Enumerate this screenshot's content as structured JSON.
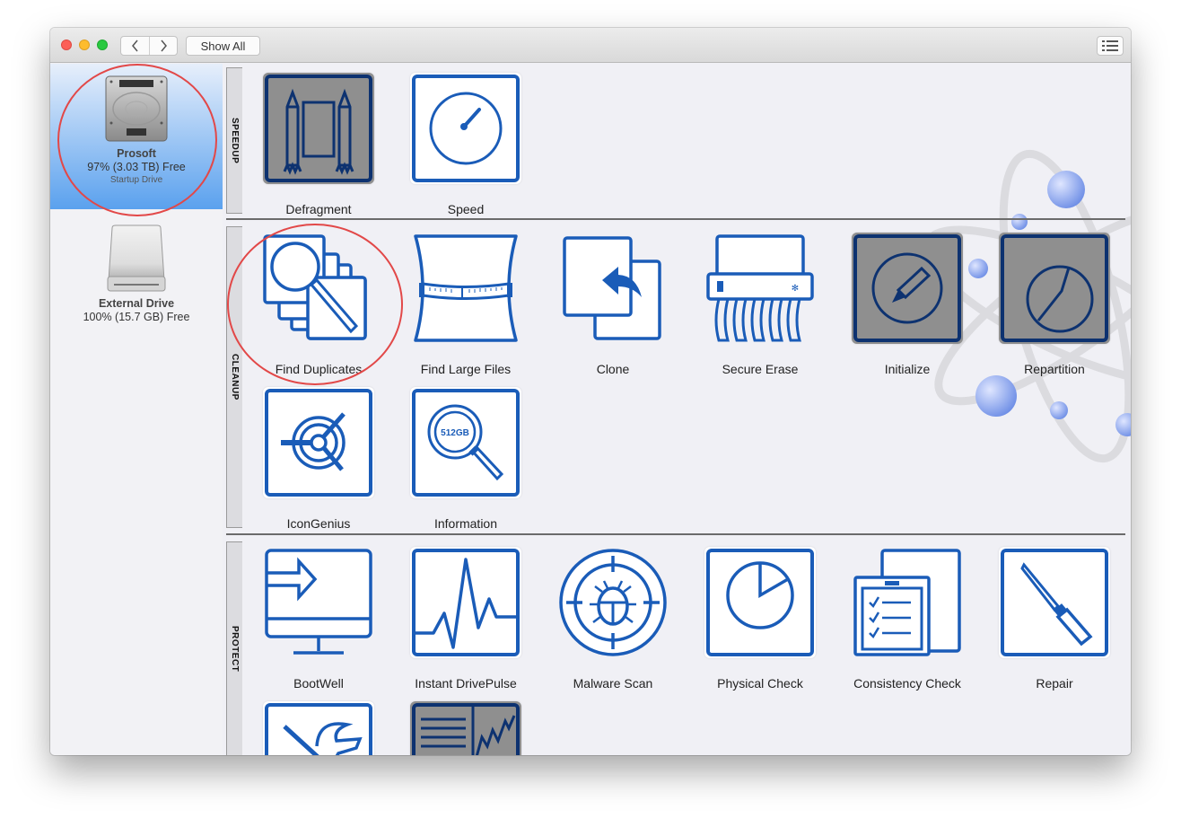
{
  "titlebar": {
    "back_label": "<",
    "forward_label": ">",
    "show_all_label": "Show All",
    "view_icon": "list-view-icon"
  },
  "sidebar": {
    "drives": [
      {
        "name": "Prosoft",
        "free": "97% (3.03 TB) Free",
        "subtitle": "Startup Drive",
        "icon": "hard-drive-icon",
        "selected": true
      },
      {
        "name": "External Drive",
        "free": "100% (15.7 GB) Free",
        "icon": "external-drive-icon",
        "selected": false
      }
    ]
  },
  "sections": [
    {
      "label": "SPEEDUP",
      "tools": [
        {
          "label": "Defragment",
          "icon": "defragment-rockets-icon",
          "enabled": false
        },
        {
          "label": "Speed",
          "icon": "speedometer-icon",
          "enabled": true
        }
      ]
    },
    {
      "label": "CLEANUP",
      "tools": [
        {
          "label": "Find Duplicates",
          "icon": "find-duplicates-icon",
          "enabled": true
        },
        {
          "label": "Find Large Files",
          "icon": "measuring-tape-icon",
          "enabled": true
        },
        {
          "label": "Clone",
          "icon": "clone-icon",
          "enabled": true
        },
        {
          "label": "Secure Erase",
          "icon": "shredder-icon",
          "enabled": true
        },
        {
          "label": "Initialize",
          "icon": "pencil-circle-icon",
          "enabled": false
        },
        {
          "label": "Repartition",
          "icon": "partition-pie-icon",
          "enabled": false
        },
        {
          "label": "IconGenius",
          "icon": "target-icon",
          "enabled": true
        },
        {
          "label": "Information",
          "icon": "magnifier-512gb-icon",
          "enabled": true,
          "badge": "512GB"
        }
      ]
    },
    {
      "label": "PROTECT",
      "tools": [
        {
          "label": "BootWell",
          "icon": "monitor-arrow-icon",
          "enabled": true
        },
        {
          "label": "Instant DrivePulse",
          "icon": "pulse-chart-icon",
          "enabled": true
        },
        {
          "label": "Malware Scan",
          "icon": "bug-crosshair-icon",
          "enabled": true
        },
        {
          "label": "Physical Check",
          "icon": "pie-chart-icon",
          "enabled": true
        },
        {
          "label": "Consistency Check",
          "icon": "clipboard-checklist-icon",
          "enabled": true
        },
        {
          "label": "Repair",
          "icon": "screwdriver-icon",
          "enabled": true
        },
        {
          "label": "",
          "icon": "tools-hammer-icon",
          "enabled": true
        },
        {
          "label": "",
          "icon": "report-graph-icon",
          "enabled": false
        }
      ]
    }
  ],
  "colors": {
    "accent_blue": "#1a5cb8",
    "disabled_tile": "#8f8f8f",
    "disabled_stroke": "#0d3270",
    "annotation_red": "#e24848",
    "selected_drive": "#5aa1ee"
  }
}
